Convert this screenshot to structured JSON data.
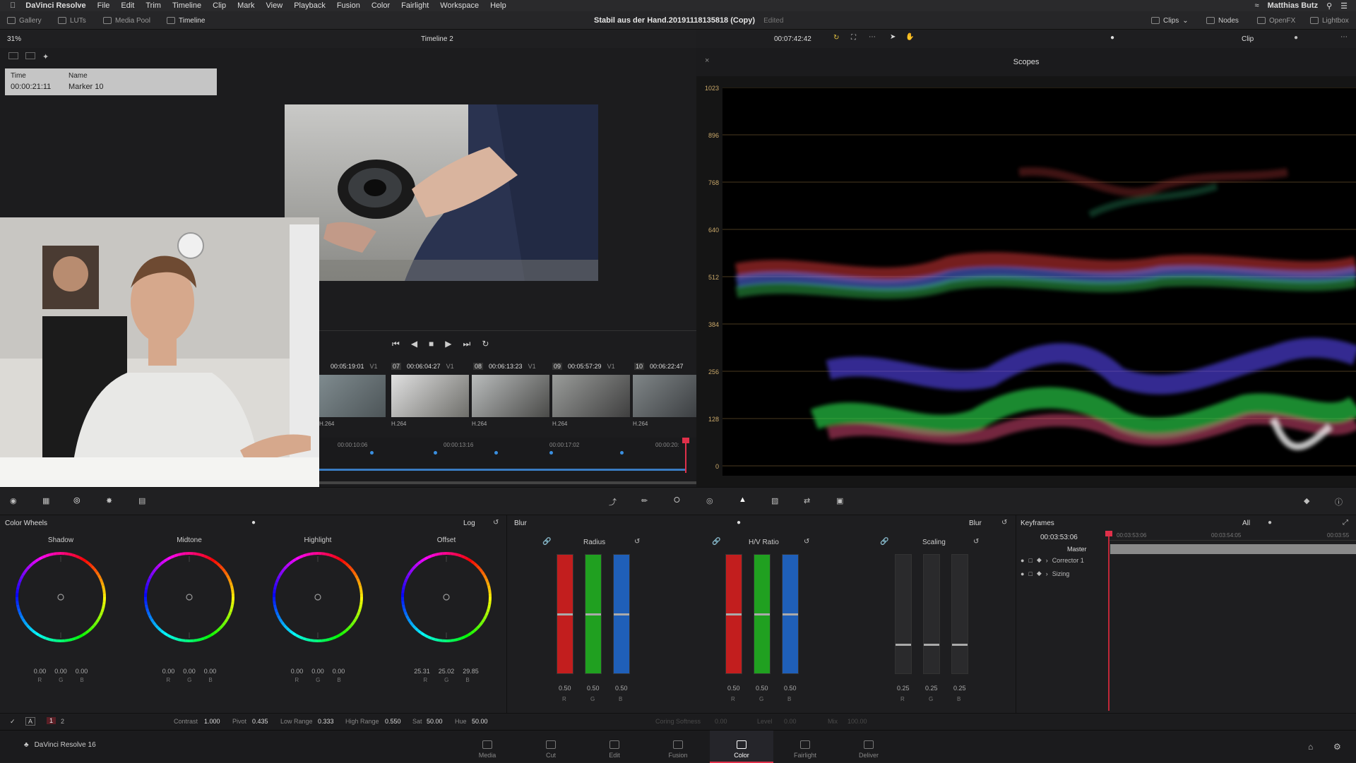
{
  "menubar": {
    "app": "DaVinci Resolve",
    "items": [
      "File",
      "Edit",
      "Trim",
      "Timeline",
      "Clip",
      "Mark",
      "View",
      "Playback",
      "Fusion",
      "Color",
      "Fairlight",
      "Workspace",
      "Help"
    ],
    "user": "Matthias Butz"
  },
  "toolbar": {
    "gallery": "Gallery",
    "luts": "LUTs",
    "media_pool": "Media Pool",
    "timeline": "Timeline",
    "project_title": "Stabil aus der Hand.20191118135818 (Copy)",
    "edited": "Edited",
    "clips": "Clips",
    "nodes": "Nodes",
    "openfx": "OpenFX",
    "lightbox": "Lightbox"
  },
  "viewer": {
    "zoom": "31%",
    "timeline_name": "Timeline 2",
    "timecode": "00:07:42:42",
    "clip_mode": "Clip",
    "marker_time_label": "Time",
    "marker_name_label": "Name",
    "marker_time": "00:00:21:11",
    "marker_name": "Marker 10"
  },
  "clips": [
    {
      "num": "",
      "tc": "00:05:19:01",
      "track": "V1",
      "codec": "H.264"
    },
    {
      "num": "07",
      "tc": "00:06:04:27",
      "track": "V1",
      "codec": "H.264"
    },
    {
      "num": "08",
      "tc": "00:06:13:23",
      "track": "V1",
      "codec": "H.264"
    },
    {
      "num": "09",
      "tc": "00:05:57:29",
      "track": "V1",
      "codec": "H.264"
    },
    {
      "num": "10",
      "tc": "00:06:22:47",
      "track": "",
      "codec": "H.264"
    }
  ],
  "ruler": [
    "00:00:10:06",
    "00:00:13:16",
    "00:00:17:02",
    "00:00:20:"
  ],
  "scopes": {
    "title": "Scopes",
    "ticks": [
      "1023",
      "896",
      "768",
      "640",
      "512",
      "384",
      "256",
      "128",
      "0"
    ]
  },
  "color_wheels": {
    "title": "Color Wheels",
    "mode": "Log",
    "wheels": [
      {
        "name": "Shadow",
        "values": [
          "0.00",
          "0.00",
          "0.00"
        ]
      },
      {
        "name": "Midtone",
        "values": [
          "0.00",
          "0.00",
          "0.00"
        ]
      },
      {
        "name": "Highlight",
        "values": [
          "0.00",
          "0.00",
          "0.00"
        ]
      },
      {
        "name": "Offset",
        "values": [
          "25.31",
          "25.02",
          "29.85"
        ]
      }
    ],
    "rgb": [
      "R",
      "G",
      "B"
    ],
    "adjust": {
      "contrast_label": "Contrast",
      "contrast": "1.000",
      "pivot_label": "Pivot",
      "pivot": "0.435",
      "low_label": "Low Range",
      "low": "0.333",
      "high_label": "High Range",
      "high": "0.550",
      "sat_label": "Sat",
      "sat": "50.00",
      "hue_label": "Hue",
      "hue": "50.00",
      "page1": "1",
      "page2": "2"
    }
  },
  "blur": {
    "title": "Blur",
    "mode": "Blur",
    "groups": [
      {
        "name": "Radius",
        "values": [
          "0.50",
          "0.50",
          "0.50"
        ]
      },
      {
        "name": "H/V Ratio",
        "values": [
          "0.50",
          "0.50",
          "0.50"
        ]
      },
      {
        "name": "Scaling",
        "values": [
          "0.25",
          "0.25",
          "0.25"
        ]
      }
    ],
    "footer": {
      "coring": "Coring Softness",
      "coring_val": "0.00",
      "level": "Level",
      "level_val": "0.00",
      "mix": "Mix",
      "mix_val": "100.00"
    }
  },
  "keyframes": {
    "title": "Keyframes",
    "filter": "All",
    "timecode": "00:03:53:06",
    "ruler": [
      "00:03:53:06",
      "00:03:54:05",
      "00:03:55"
    ],
    "tracks": [
      "Master",
      "Corrector 1",
      "Sizing"
    ]
  },
  "footer": {
    "product": "DaVinci Resolve 16",
    "pages": [
      "Media",
      "Cut",
      "Edit",
      "Fusion",
      "Color",
      "Fairlight",
      "Deliver"
    ],
    "active_page": "Color"
  }
}
